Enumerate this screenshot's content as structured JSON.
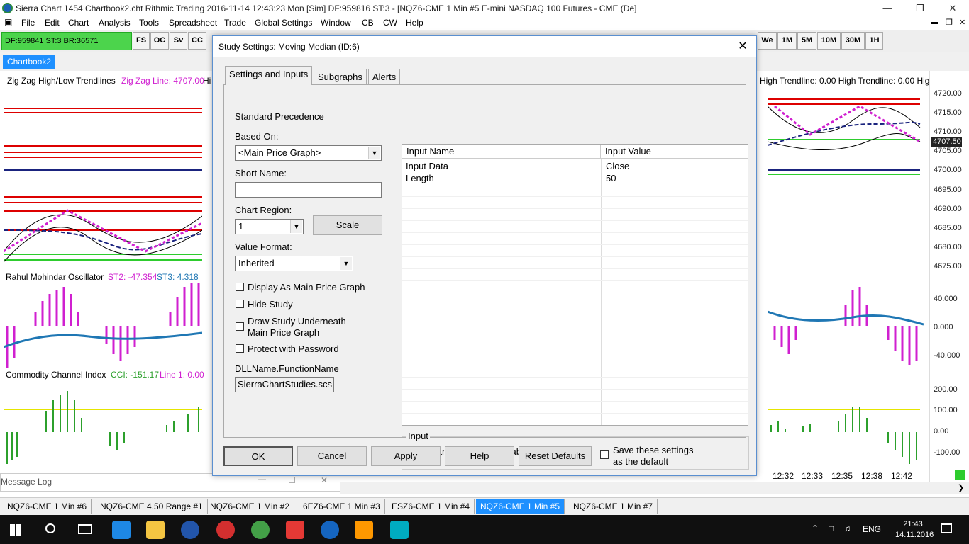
{
  "window": {
    "title": "Sierra Chart 1454 Chartbook2.cht  Rithmic Trading 2016-11-14  12:43:23 Mon [Sim]  DF:959816  ST:3 - [NQZ6-CME  1 Min  #5  E-mini NASDAQ 100 Futures - CME (De]"
  },
  "menu": [
    "File",
    "Edit",
    "Chart",
    "Analysis",
    "Tools",
    "Spreadsheet",
    "Trade",
    "Global Settings",
    "Window",
    "CB",
    "CW",
    "Help"
  ],
  "toolbar": {
    "status": "DF:959841  ST:3  BR:36571",
    "left_buttons": [
      "FS",
      "OC",
      "Sv",
      "CC"
    ],
    "right_buttons": [
      "We",
      "1M",
      "5M",
      "10M",
      "30M",
      "1H"
    ]
  },
  "chartbook_tab": "Chartbook2",
  "chart": {
    "study1_left": "Zig Zag High/Low Trendlines",
    "study1_value": "Zig Zag Line: 4707.00",
    "study1_left_cut": "Hi",
    "study1_right": "High Trendline: 0.00  High Trendline: 0.00  Hig",
    "study2_name": "Rahul Mohindar Oscillator",
    "study2_st2": "ST2: -47.354",
    "study2_st3": "ST3: 4.318",
    "study3_name": "Commodity Channel Index",
    "study3_cci": "CCI: -151.17",
    "study3_line": "Line 1: 0.00",
    "price_labels": [
      "4720.00",
      "4715.00",
      "4710.00",
      "4705.00",
      "4700.00",
      "4695.00",
      "4690.00",
      "4685.00",
      "4680.00",
      "4675.00"
    ],
    "current_price": "4707.50",
    "osc_labels": [
      "40.000",
      "0.000",
      "-40.000"
    ],
    "cci_labels": [
      "200.00",
      "100.00",
      "0.00",
      "-100.00"
    ],
    "time_labels": [
      "12:32",
      "12:33",
      "12:35",
      "12:38",
      "12:42"
    ]
  },
  "message_log": "Message Log",
  "bottom_tabs": [
    "NQZ6-CME  1 Min  #6",
    "NQZ6-CME  4.50 Range  #1",
    "NQZ6-CME  1 Min  #2",
    "6EZ6-CME  1 Min  #3",
    "ESZ6-CME  1 Min  #4",
    "NQZ6-CME  1 Min  #5",
    "NQZ6-CME  1 Min  #7"
  ],
  "taskbar": {
    "lang": "ENG",
    "time": "21:43",
    "date": "14.11.2016"
  },
  "dialog": {
    "title": "Study Settings: Moving Median (ID:6)",
    "tabs": [
      "Settings and Inputs",
      "Subgraphs",
      "Alerts"
    ],
    "standard_precedence": "Standard Precedence",
    "based_on_label": "Based On:",
    "based_on_value": "<Main Price Graph>",
    "short_name_label": "Short Name:",
    "short_name_value": "",
    "chart_region_label": "Chart Region:",
    "chart_region_value": "1",
    "scale_button": "Scale",
    "value_format_label": "Value Format:",
    "value_format_value": "Inherited",
    "checkboxes": [
      "Display As Main Price Graph",
      "Hide Study",
      "Draw Study Underneath",
      "Main Price Graph",
      "Protect with Password"
    ],
    "dll_label": "DLLName.FunctionName",
    "dll_value": "SierraChartStudies.scs",
    "grid_headers": [
      "Input Name",
      "Input Value"
    ],
    "inputs": [
      {
        "name": "Input Data",
        "value": "Close"
      },
      {
        "name": "Length",
        "value": "50"
      }
    ],
    "input_group_title": "Input",
    "input_group_text": "Select an input in the list above",
    "buttons": [
      "OK",
      "Cancel",
      "Apply",
      "Help",
      "Reset Defaults"
    ],
    "save_default_line1": "Save these settings",
    "save_default_line2": "as the default"
  }
}
